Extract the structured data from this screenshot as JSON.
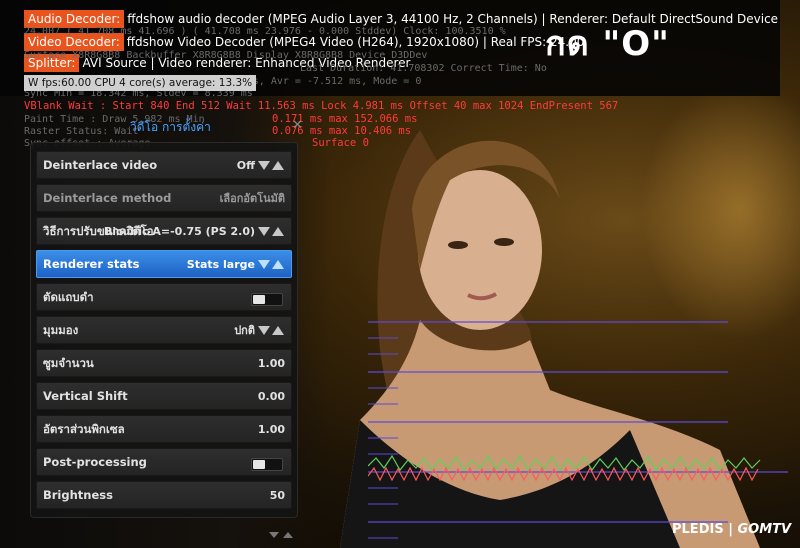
{
  "osd": {
    "audio_label": "Audio Decoder:",
    "audio_text": "ffdshow audio decoder (MPEG Audio Layer 3, 44100 Hz, 2 Channels) | Renderer: Default DirectSound Device",
    "video_label": "Video Decoder:",
    "video_text": "ffdshow Video Decoder (MPEG4 Video (H264), 1920x1080) | Real FPS: 24.00",
    "splitter_label": "Splitter:",
    "splitter_text": "AVI Source | Video renderer: Enhanced Video Renderer",
    "fps_text": "W fps:60.00 CPU 4 core(s) average: 13.3%",
    "hint": "กด \"O\"",
    "stats_line1": "24.007   ( 41.708 ms   41.696 )   ( 41.708 ms    23.976 - 0.000 Stddev)  Clock: 100.3510 %",
    "stats_line2": "Surface  X8R8G8B8   Backbuffer X8R8G8B8   Display X8R8G8B8    Device D3DDev",
    "stats_line3": "    Last Duration:  41.708302      Correct        Time: No",
    "stats_line4": "Jitter   Min  =   1.237 ms, Stdev =   1.011 ms, Avr =  -7.512 ms, Mode = 0",
    "stats_line5": "Sync     Min  =  18.342 ms, Stdev =   8.339 ms",
    "stats_vblank": "VBlank Wait  : Start  840   End  512   Wait  11.563 ms   Lock   4.981 ms   Offset   40   max 1024   EndPresent  567",
    "stats_paint_label": "Paint Time   : Draw   5.982 ms   Min",
    "stats_paint_red": "0.171 ms   max 152.066 ms",
    "stats_raster_label": "Raster Status: Wait",
    "stats_raster_red": "0.076 ms   max  10.406 ms",
    "stats_surface_label": "Sync offset  : Average",
    "stats_surface_red": "Surface  0"
  },
  "menu": {
    "title": "วิดีโอ การตั้งค่า",
    "close": "✕",
    "items": [
      {
        "label": "Deinterlace video",
        "value": "Off"
      },
      {
        "label": "Deinterlace method",
        "value": "เลือกอัตโนมัติ"
      },
      {
        "label": "วิธีการปรับขนาดวิดีโอ",
        "value": "Bicubic A=-0.75 (PS 2.0)"
      },
      {
        "label": "Renderer stats",
        "value": "Stats large"
      },
      {
        "label": "ตัดแถบดำ",
        "value": ""
      },
      {
        "label": "มุมมอง",
        "value": "ปกติ"
      },
      {
        "label": "ซูมจำนวน",
        "value": "1.00"
      },
      {
        "label": "Vertical Shift",
        "value": "0.00"
      },
      {
        "label": "อัตราส่วนพิกเซล",
        "value": "1.00"
      },
      {
        "label": "Post-processing",
        "value": ""
      },
      {
        "label": "Brightness",
        "value": "50"
      }
    ]
  },
  "logo": {
    "left": "PLEDIS",
    "sep": "|",
    "right": "GOMTV"
  }
}
